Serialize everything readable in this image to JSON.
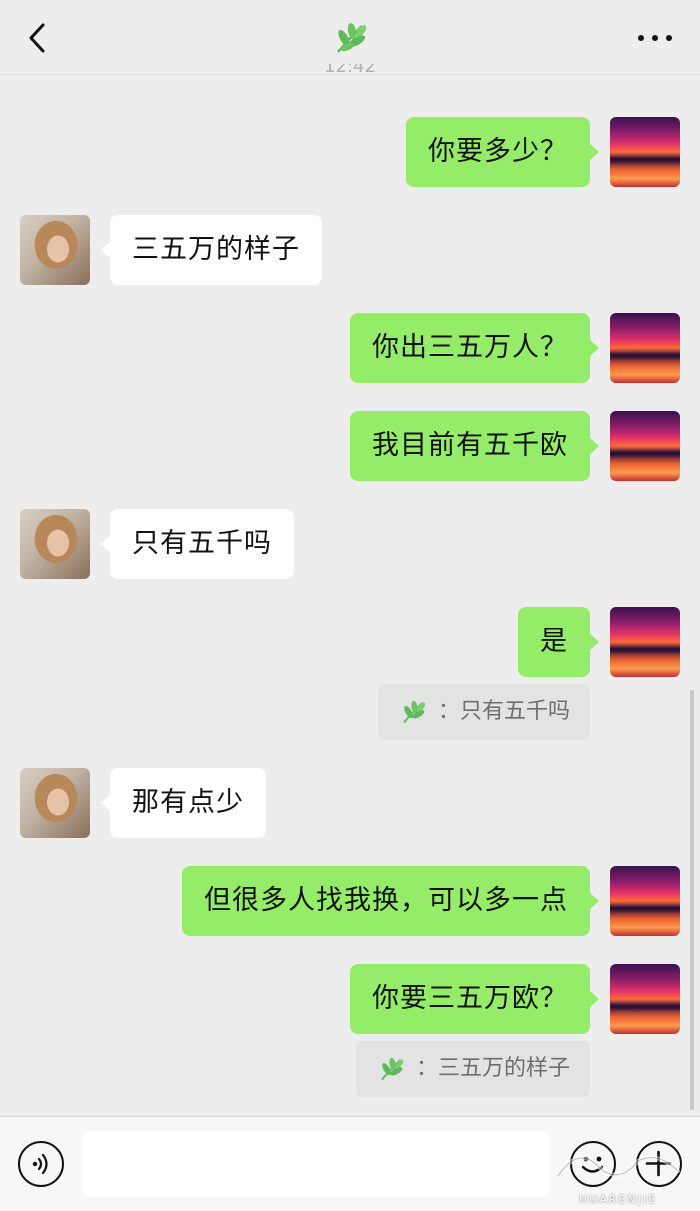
{
  "header": {
    "back_icon": "chevron-left-icon",
    "title_icon": "leaf-icon",
    "more_icon": "more-dots-icon"
  },
  "timestamp": "12:42",
  "messages": [
    {
      "side": "out",
      "text": "你要多少？"
    },
    {
      "side": "in",
      "text": "三五万的样子"
    },
    {
      "side": "out",
      "text": "你出三五万人？"
    },
    {
      "side": "out",
      "text": "我目前有五千欧"
    },
    {
      "side": "in",
      "text": "只有五千吗"
    },
    {
      "side": "out",
      "text": "是",
      "quote": "：只有五千吗"
    },
    {
      "side": "in",
      "text": "那有点少"
    },
    {
      "side": "out",
      "text": "但很多人找我换，可以多一点"
    },
    {
      "side": "out",
      "text": "你要三五万欧？",
      "quote": "：三五万的样子"
    }
  ],
  "input_bar": {
    "voice_icon": "voice-icon",
    "input_value": "",
    "emoji_icon": "emoji-icon",
    "plus_icon": "plus-icon"
  },
  "watermark": "HUARENJIE",
  "colors": {
    "outgoing_bubble": "#95ec69",
    "incoming_bubble": "#ffffff",
    "background": "#ededed",
    "leaf": "#5fb85a"
  }
}
